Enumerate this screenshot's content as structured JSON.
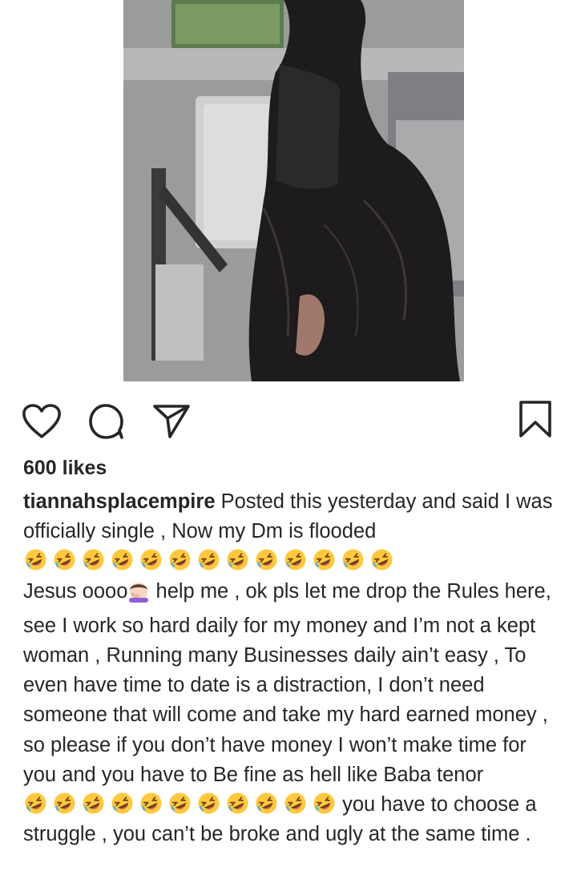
{
  "post": {
    "image_alt": "Photo of a woman in black lace bodysuit and corset in a room with folding chairs",
    "likes_text": "600 likes",
    "username": "tiannahsplacempire",
    "caption_part1": " Posted this yesterday and said I was officially single , Now my Dm is flooded ",
    "emoji_group1_count": 13,
    "emoji_group1_name": "rolling-on-the-floor-laughing",
    "caption_part2": "Jesus oooo",
    "facepalm_emoji_name": "woman-facepalming",
    "caption_part3": " help me , ok pls let me drop the Rules here, see I work so hard daily for my money and I’m not a kept woman , Running many Businesses daily ain’t easy , To even have time to date is a distraction, I don’t need someone that will come and take my hard earned money , so please if you don’t have money I won’t make time for you and you have to Be fine as hell like Baba tenor ",
    "emoji_group2_count": 11,
    "caption_part4": " you have to choose a struggle , you can’t be broke and ugly at the same time ."
  },
  "actions": {
    "like_icon": "heart-icon",
    "comment_icon": "comment-bubble-icon",
    "share_icon": "paper-plane-icon",
    "save_icon": "bookmark-icon"
  },
  "colors": {
    "text": "#262626",
    "icon": "#262626",
    "emoji_face": "#FFC83D"
  }
}
